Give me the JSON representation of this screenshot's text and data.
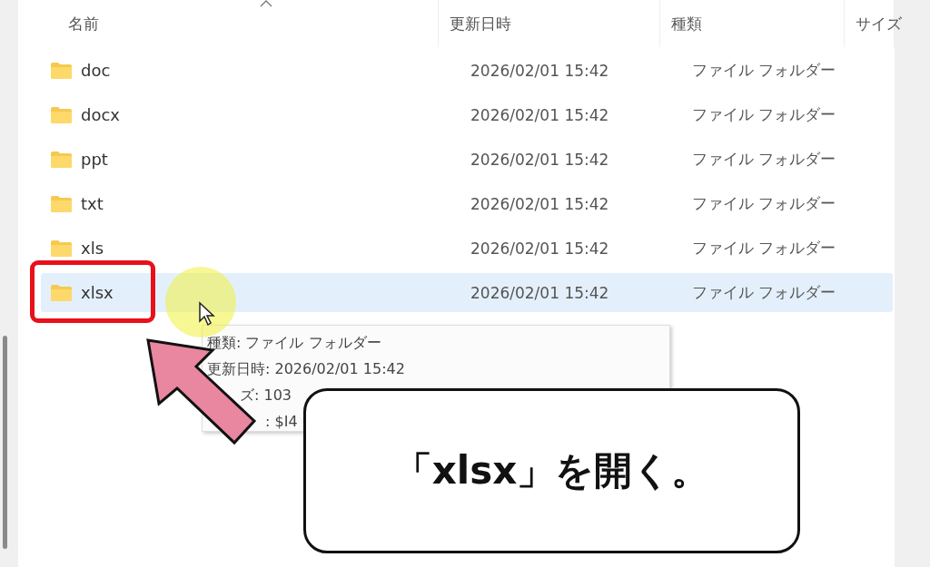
{
  "columns": [
    {
      "label": "名前"
    },
    {
      "label": "更新日時"
    },
    {
      "label": "種類"
    },
    {
      "label": "サイズ"
    }
  ],
  "rows": [
    {
      "name": "doc",
      "modified": "2026/02/01 15:42",
      "type": "ファイル フォルダー",
      "selected": false
    },
    {
      "name": "docx",
      "modified": "2026/02/01 15:42",
      "type": "ファイル フォルダー",
      "selected": false
    },
    {
      "name": "ppt",
      "modified": "2026/02/01 15:42",
      "type": "ファイル フォルダー",
      "selected": false
    },
    {
      "name": "txt",
      "modified": "2026/02/01 15:42",
      "type": "ファイル フォルダー",
      "selected": false
    },
    {
      "name": "xls",
      "modified": "2026/02/01 15:42",
      "type": "ファイル フォルダー",
      "selected": false
    },
    {
      "name": "xlsx",
      "modified": "2026/02/01 15:42",
      "type": "ファイル フォルダー",
      "selected": true
    }
  ],
  "tooltip": {
    "lines": [
      "種類: ファイル フォルダー",
      "更新日時: 2026/02/01 15:42",
      "ズ: 103",
      ": $I4"
    ]
  },
  "callout": {
    "text": "「xlsx」を開く。"
  }
}
